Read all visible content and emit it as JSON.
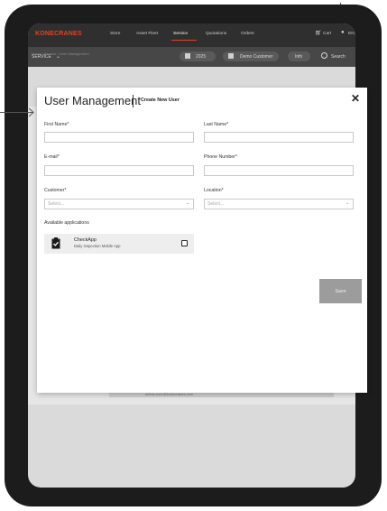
{
  "header": {
    "logo": "KONECRANES",
    "nav": [
      "Store",
      "Asset Fleet",
      "Service",
      "Quotations",
      "Orders"
    ],
    "cart": "Cart",
    "language": "EN"
  },
  "subheader": {
    "section": "SERVICE",
    "year": "2025",
    "customer": "Demo Customer",
    "info": "Info",
    "search": "Search"
  },
  "breadcrumb": "Home / Service / User Management",
  "background": {
    "email": "admin.user@konecranes.com"
  },
  "modal": {
    "title": "User Management",
    "subtitle": "Create New User",
    "close": "✕",
    "fields": {
      "first_name": "First Name*",
      "last_name": "Last Name*",
      "email": "E-mail*",
      "phone": "Phone Number*",
      "customer": "Customer*",
      "location": "Location*",
      "select_placeholder": "Select..."
    },
    "apps_label": "Available applications",
    "app": {
      "name": "CheckApp",
      "description": "Daily Inspection Mobile App"
    },
    "save": "Save"
  },
  "colors": {
    "brand": "#e8401f",
    "topbar": "#2f2f2f",
    "subbar": "#474747",
    "save_button": "#9c9c9c"
  }
}
